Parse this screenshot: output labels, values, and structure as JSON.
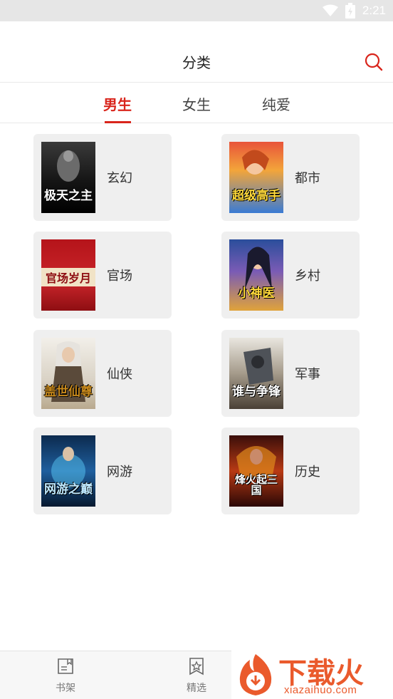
{
  "status_bar": {
    "time": "2:21"
  },
  "header": {
    "title": "分类"
  },
  "tabs": [
    {
      "label": "男生",
      "active": true
    },
    {
      "label": "女生",
      "active": false
    },
    {
      "label": "纯爱",
      "active": false
    }
  ],
  "categories": [
    {
      "label": "玄幻",
      "cover_title": "极天之主"
    },
    {
      "label": "都市",
      "cover_title": "超级高手"
    },
    {
      "label": "官场",
      "cover_title": "官场岁月"
    },
    {
      "label": "乡村",
      "cover_title": "小神医"
    },
    {
      "label": "仙侠",
      "cover_title": "盖世仙尊"
    },
    {
      "label": "军事",
      "cover_title": "谁与争锋"
    },
    {
      "label": "网游",
      "cover_title": "网游之巅"
    },
    {
      "label": "历史",
      "cover_title": "烽火起三国"
    }
  ],
  "bottom_nav": [
    {
      "label": "书架",
      "icon": "bookshelf-icon"
    },
    {
      "label": "精选",
      "icon": "star-bookmark-icon"
    }
  ],
  "watermark": {
    "text": "下载火",
    "url": "xiazaihuo.com"
  },
  "colors": {
    "accent": "#d9251c",
    "card_bg": "#efefef",
    "watermark": "#ea5a2c"
  }
}
